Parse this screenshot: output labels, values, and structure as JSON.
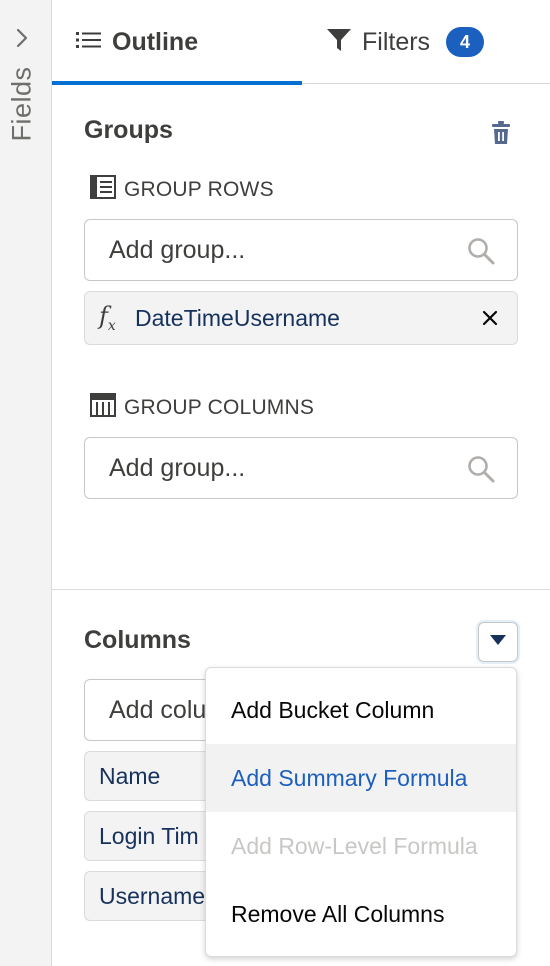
{
  "rail": {
    "label": "Fields"
  },
  "tabs": {
    "outline_label": "Outline",
    "filters_label": "Filters",
    "filters_count": "4"
  },
  "groups": {
    "title": "Groups",
    "rows_label": "GROUP ROWS",
    "rows_placeholder": "Add group...",
    "row_items": [
      "DateTimeUsername"
    ],
    "columns_label": "GROUP COLUMNS",
    "columns_placeholder": "Add group..."
  },
  "columns": {
    "title": "Columns",
    "input_placeholder": "Add colu",
    "items": [
      "Name",
      "Login Tim",
      "Username"
    ]
  },
  "menu": {
    "items": [
      {
        "label": "Add Bucket Column",
        "state": "normal"
      },
      {
        "label": "Add Summary Formula",
        "state": "hover"
      },
      {
        "label": "Add Row-Level Formula",
        "state": "disabled"
      },
      {
        "label": "Remove All Columns",
        "state": "normal"
      }
    ]
  },
  "colors": {
    "accent": "#0070d2",
    "badge": "#1b5fbf",
    "hover_text": "#1b5fbf",
    "disabled_text": "#c9c7c5"
  }
}
